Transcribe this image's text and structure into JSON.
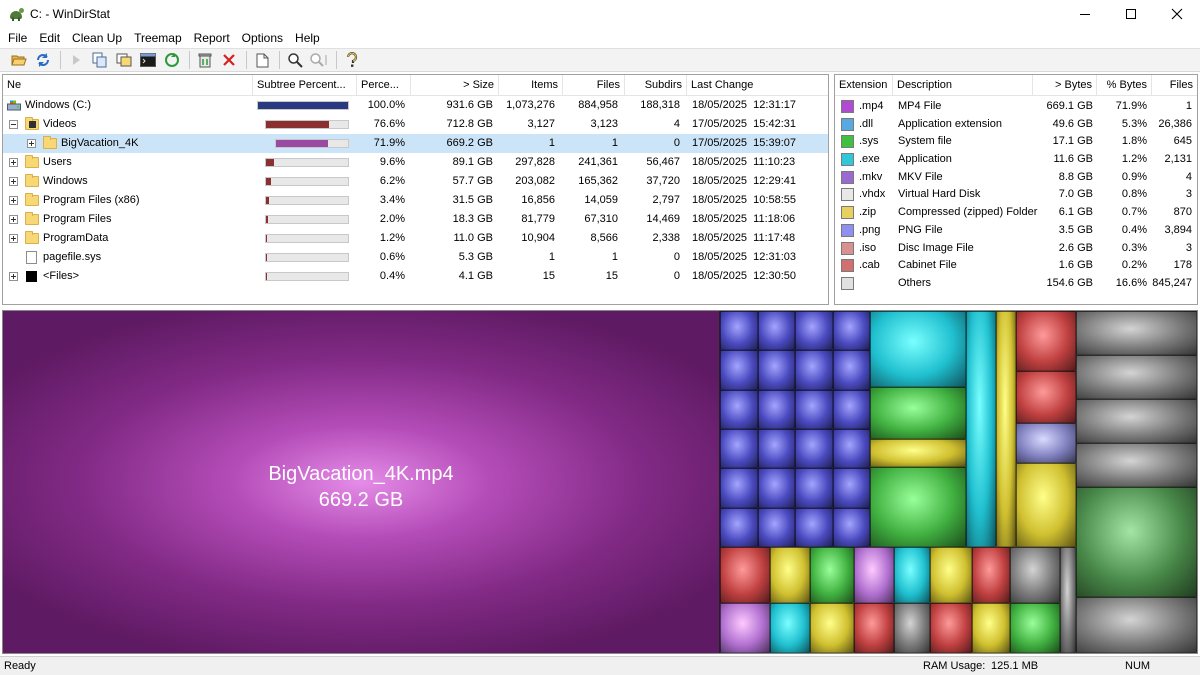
{
  "window": {
    "title": "C: - WinDirStat"
  },
  "menu": [
    "File",
    "Edit",
    "Clean Up",
    "Treemap",
    "Report",
    "Options",
    "Help"
  ],
  "toolbar": {
    "buttons": [
      "open-icon",
      "refresh-icon",
      "play-icon",
      "copy-path-icon",
      "explorer-icon",
      "command-prompt-icon",
      "refresh-selected-icon",
      "recycle-bin-icon",
      "delete-icon",
      "properties-icon",
      "zoom-in-icon",
      "zoom-out-icon",
      "help-icon"
    ]
  },
  "tree": {
    "headers": [
      "Ne",
      "Subtree Percent...",
      "Perce...",
      "> Size",
      "Items",
      "Files",
      "Subdirs",
      "Last Change"
    ],
    "rows": [
      {
        "name": "Windows (C:)",
        "icon": "drive",
        "level": 0,
        "expander": "none",
        "percent": "100.0%",
        "fill": 1.0,
        "size": "931.6 GB",
        "items": "1,073,276",
        "files": "884,958",
        "subdirs": "188,318",
        "changed": "18/05/2025  12:31:17"
      },
      {
        "name": "Videos",
        "icon": "video-folder",
        "level": 1,
        "expander": "minus",
        "percent": "76.6%",
        "fill": 0.766,
        "size": "712.8 GB",
        "items": "3,127",
        "files": "3,123",
        "subdirs": "4",
        "changed": "17/05/2025  15:42:31"
      },
      {
        "name": "BigVacation_4K",
        "icon": "folder",
        "level": 2,
        "expander": "plus",
        "percent": "71.9%",
        "fill": 0.719,
        "size": "669.2 GB",
        "items": "1",
        "files": "1",
        "subdirs": "0",
        "changed": "17/05/2025  15:39:07",
        "selected": true
      },
      {
        "name": "Users",
        "icon": "folder",
        "level": 1,
        "expander": "plus",
        "percent": "9.6%",
        "fill": 0.096,
        "size": "89.1 GB",
        "items": "297,828",
        "files": "241,361",
        "subdirs": "56,467",
        "changed": "18/05/2025  11:10:23"
      },
      {
        "name": "Windows",
        "icon": "folder",
        "level": 1,
        "expander": "plus",
        "percent": "6.2%",
        "fill": 0.062,
        "size": "57.7 GB",
        "items": "203,082",
        "files": "165,362",
        "subdirs": "37,720",
        "changed": "18/05/2025  12:29:41"
      },
      {
        "name": "Program Files (x86)",
        "icon": "folder",
        "level": 1,
        "expander": "plus",
        "percent": "3.4%",
        "fill": 0.034,
        "size": "31.5 GB",
        "items": "16,856",
        "files": "14,059",
        "subdirs": "2,797",
        "changed": "18/05/2025  10:58:55"
      },
      {
        "name": "Program Files",
        "icon": "folder",
        "level": 1,
        "expander": "plus",
        "percent": "2.0%",
        "fill": 0.02,
        "size": "18.3 GB",
        "items": "81,779",
        "files": "67,310",
        "subdirs": "14,469",
        "changed": "18/05/2025  11:18:06"
      },
      {
        "name": "ProgramData",
        "icon": "folder",
        "level": 1,
        "expander": "plus",
        "percent": "1.2%",
        "fill": 0.012,
        "size": "11.0 GB",
        "items": "10,904",
        "files": "8,566",
        "subdirs": "2,338",
        "changed": "18/05/2025  11:17:48"
      },
      {
        "name": "pagefile.sys",
        "icon": "file",
        "level": 1,
        "expander": "none",
        "percent": "0.6%",
        "fill": 0.006,
        "size": "5.3 GB",
        "items": "1",
        "files": "1",
        "subdirs": "0",
        "changed": "18/05/2025  12:31:03"
      },
      {
        "name": "<Files>",
        "icon": "files",
        "level": 1,
        "expander": "plus",
        "percent": "0.4%",
        "fill": 0.004,
        "size": "4.1 GB",
        "items": "15",
        "files": "15",
        "subdirs": "0",
        "changed": "18/05/2025  12:30:50"
      }
    ]
  },
  "extensions": {
    "headers": [
      "Extension",
      "Description",
      "> Bytes",
      "% Bytes",
      "Files"
    ],
    "rows": [
      {
        "ext": ".mp4",
        "desc": "MP4 File",
        "bytes": "669.1 GB",
        "pct": "71.9%",
        "files": "1",
        "color": "#b04ad0"
      },
      {
        "ext": ".dll",
        "desc": "Application extension",
        "bytes": "49.6 GB",
        "pct": "5.3%",
        "files": "26,386",
        "color": "#5aa8e0"
      },
      {
        "ext": ".sys",
        "desc": "System file",
        "bytes": "17.1 GB",
        "pct": "1.8%",
        "files": "645",
        "color": "#40c040"
      },
      {
        "ext": ".exe",
        "desc": "Application",
        "bytes": "11.6 GB",
        "pct": "1.2%",
        "files": "2,131",
        "color": "#30c8d8"
      },
      {
        "ext": ".mkv",
        "desc": "MKV File",
        "bytes": "8.8 GB",
        "pct": "0.9%",
        "files": "4",
        "color": "#9a6ad0"
      },
      {
        "ext": ".vhdx",
        "desc": "Virtual Hard Disk",
        "bytes": "7.0 GB",
        "pct": "0.8%",
        "files": "3",
        "color": "#e8e8e8"
      },
      {
        "ext": ".zip",
        "desc": "Compressed (zipped) Folder",
        "bytes": "6.1 GB",
        "pct": "0.7%",
        "files": "870",
        "color": "#e8d060"
      },
      {
        "ext": ".png",
        "desc": "PNG File",
        "bytes": "3.5 GB",
        "pct": "0.4%",
        "files": "3,894",
        "color": "#9090f0"
      },
      {
        "ext": ".iso",
        "desc": "Disc Image File",
        "bytes": "2.6 GB",
        "pct": "0.3%",
        "files": "3",
        "color": "#d89090"
      },
      {
        "ext": ".cab",
        "desc": "Cabinet File",
        "bytes": "1.6 GB",
        "pct": "0.2%",
        "files": "178",
        "color": "#d07070"
      },
      {
        "ext": "",
        "desc": "Others",
        "bytes": "154.6 GB",
        "pct": "16.6%",
        "files": "845,247",
        "color": "#e0e0e0"
      }
    ]
  },
  "treemap": {
    "label_name": "BigVacation_4K.mp4",
    "label_size": "669.2 GB",
    "colors": {
      "mp4": "#a040a8",
      "dll": "#4a4ac0",
      "exe": "#20c0d0",
      "sys": "#40b040",
      "zip": "#d0c030",
      "iso": "#c04040",
      "other": "#7a7a7a"
    }
  },
  "status": {
    "left": "Ready",
    "ram_label": "RAM Usage:",
    "ram_value": "125.1 MB",
    "num": "NUM"
  },
  "colors": {
    "bar_root": "#2a3a80",
    "bar_sub": "#8a3030",
    "bar_selected": "#9a4aa0",
    "selection": "#cce4f7"
  }
}
